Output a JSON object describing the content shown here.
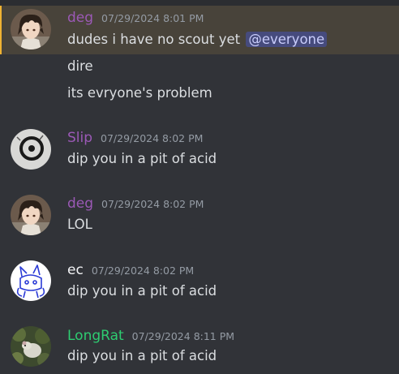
{
  "colors": {
    "background": "#313338",
    "mention_highlight": "#48433a",
    "mention_bar": "#f0b232",
    "message_text": "#dbdee1",
    "timestamp_text": "#949ba4"
  },
  "messages": [
    {
      "username": "deg",
      "username_color": "#9b59b6",
      "timestamp": "07/29/2024 8:01 PM",
      "avatar": "anime-boy-avatar",
      "lines": [
        {
          "text": "dudes i have no scout yet",
          "mention": "@everyone"
        },
        {
          "text": "dire"
        },
        {
          "text": "its evryone's problem"
        }
      ]
    },
    {
      "username": "Slip",
      "username_color": "#9b59b6",
      "timestamp": "07/29/2024 8:02 PM",
      "avatar": "ink-circle-avatar",
      "lines": [
        {
          "text": "dip you in a pit of acid"
        }
      ]
    },
    {
      "username": "deg",
      "username_color": "#9b59b6",
      "timestamp": "07/29/2024 8:02 PM",
      "avatar": "anime-boy-avatar",
      "lines": [
        {
          "text": "LOL"
        }
      ]
    },
    {
      "username": "ec",
      "username_color": "#f2f3f5",
      "timestamp": "07/29/2024 8:02 PM",
      "avatar": "sketch-creature-avatar",
      "lines": [
        {
          "text": "dip you in a pit of acid"
        }
      ]
    },
    {
      "username": "LongRat",
      "username_color": "#2ecc71",
      "timestamp": "07/29/2024 8:11 PM",
      "avatar": "rat-photo-avatar",
      "lines": [
        {
          "text": "dip you in a pit of acid"
        }
      ]
    }
  ]
}
